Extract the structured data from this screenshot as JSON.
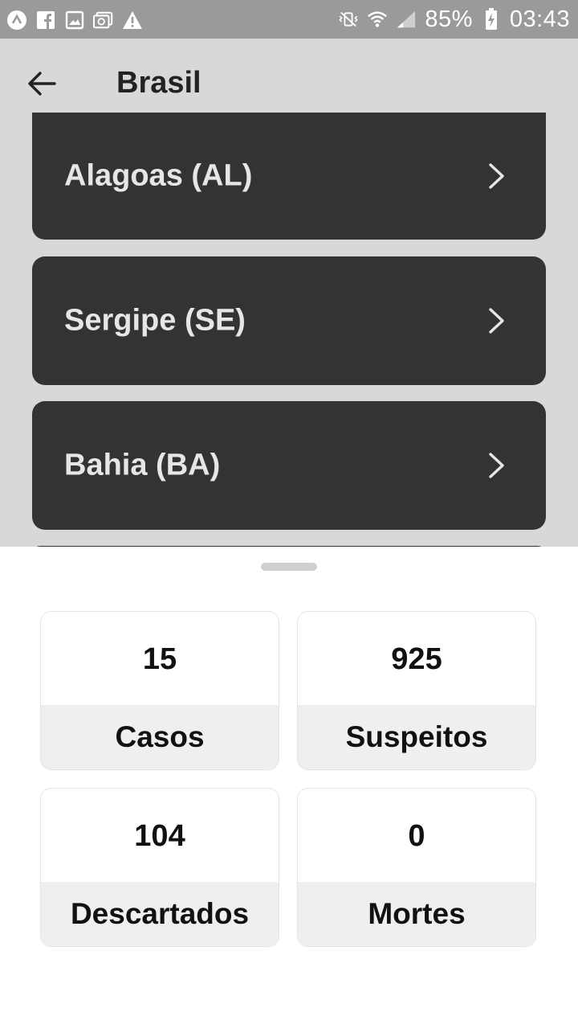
{
  "status_bar": {
    "battery": "85%",
    "time": "03:43",
    "icons_left": [
      "app-icon",
      "facebook-icon",
      "gallery-icon",
      "email-icon",
      "warning-icon"
    ],
    "icons_right": [
      "vibrate-mute-icon",
      "wifi-icon",
      "signal-icon",
      "battery-charging-icon"
    ]
  },
  "appbar": {
    "title": "Brasil",
    "back_icon": "arrow-left-icon"
  },
  "states": [
    {
      "label": "Alagoas (AL)"
    },
    {
      "label": "Sergipe (SE)"
    },
    {
      "label": "Bahia (BA)"
    }
  ],
  "stats": [
    {
      "value": "15",
      "label": "Casos"
    },
    {
      "value": "925",
      "label": "Suspeitos"
    },
    {
      "value": "104",
      "label": "Descartados"
    },
    {
      "value": "0",
      "label": "Mortes"
    }
  ]
}
